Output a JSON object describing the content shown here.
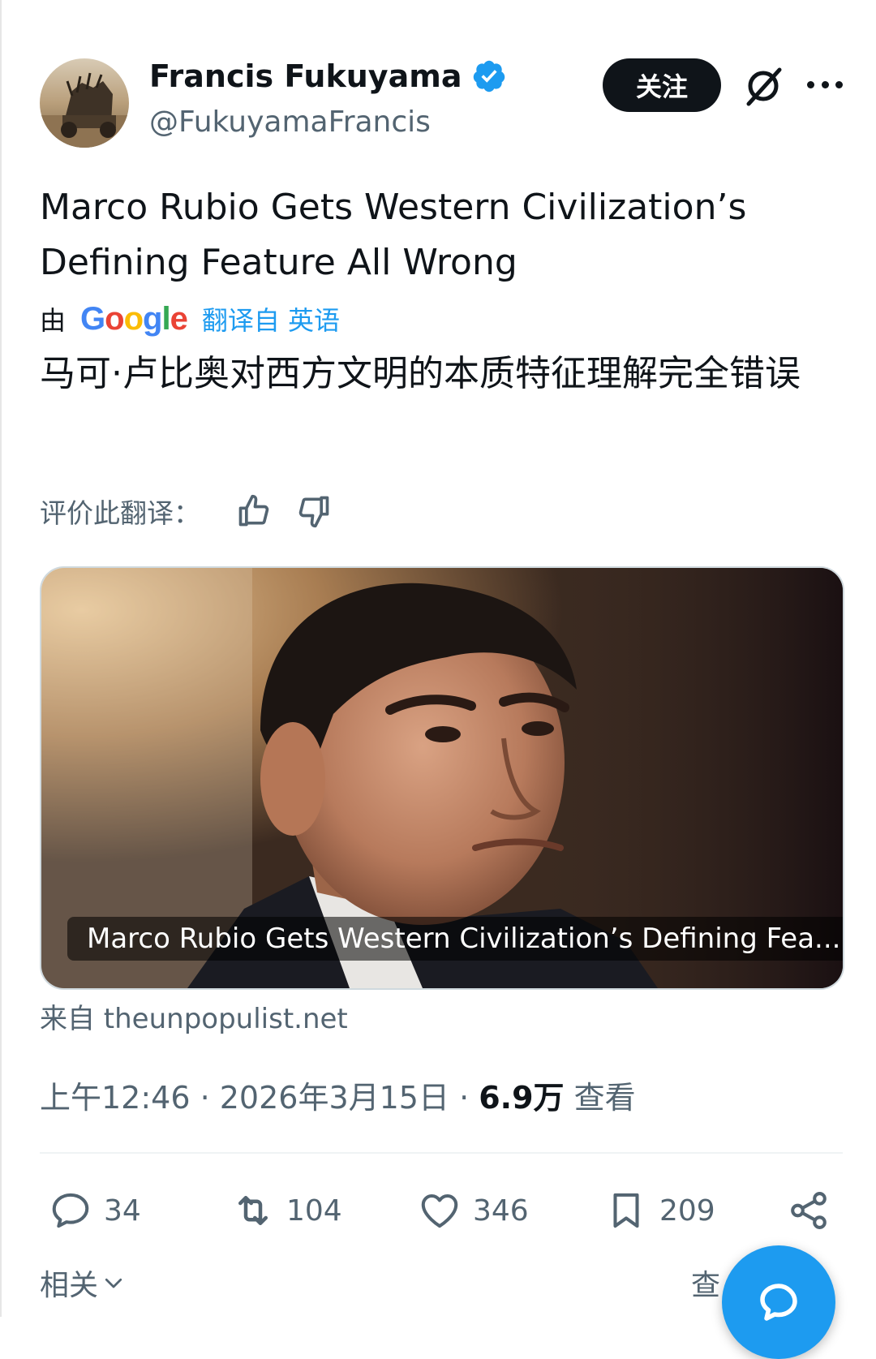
{
  "author": {
    "display_name": "Francis Fukuyama",
    "handle": "@FukuyamaFrancis",
    "verified": true,
    "verified_color": "#1d9bf0",
    "follow_label": "关注"
  },
  "tweet": {
    "text": "Marco Rubio Gets Western Civilization’s Defining Feature All Wrong",
    "translation": {
      "by_label": "由",
      "provider": "Google",
      "link_label": "翻译自 英语",
      "text": "马可·卢比奥对西方文明的本质特征理解完全错误",
      "rate_label": "评价此翻译："
    },
    "card": {
      "title": "Marco Rubio Gets Western Civilization’s Defining Fea...",
      "source": "来自 theunpopulist.net"
    },
    "meta": {
      "time": "上午12:46 · 2026年3月15日 · ",
      "views_count": "6.9万",
      "views_label": " 查看"
    }
  },
  "actions": {
    "replies": "34",
    "retweets": "104",
    "likes": "346",
    "bookmarks": "209"
  },
  "bottom": {
    "related_label": "相关",
    "query_label": "查"
  },
  "colors": {
    "accent": "#1d9bf0",
    "text_primary": "#0f1419",
    "text_secondary": "#536471"
  }
}
